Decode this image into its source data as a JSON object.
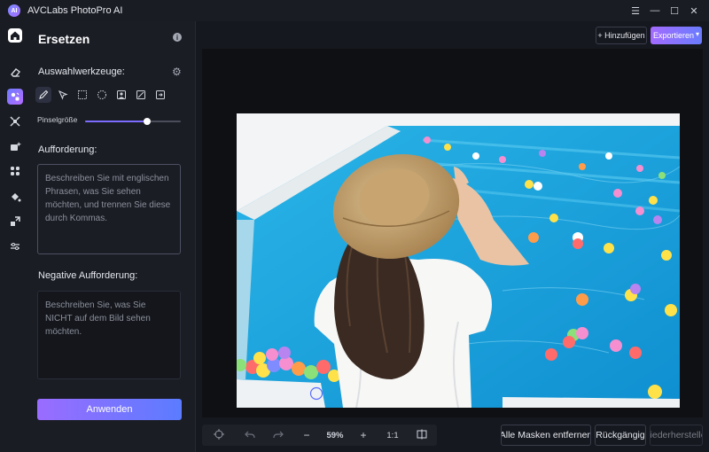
{
  "window": {
    "title": "AVCLabs PhotoPro AI",
    "logo_text": "AI",
    "controls": [
      "☰",
      "—",
      "☐",
      "✕"
    ]
  },
  "rail": {
    "items": [
      {
        "name": "home-icon"
      },
      {
        "name": "eraser-icon"
      },
      {
        "name": "replace-icon",
        "active": true
      },
      {
        "name": "upscale-icon"
      },
      {
        "name": "enhance-icon"
      },
      {
        "name": "face-icon"
      },
      {
        "name": "colorize-icon"
      },
      {
        "name": "resize-icon"
      },
      {
        "name": "adjust-icon"
      }
    ]
  },
  "panel": {
    "title": "Ersetzen",
    "selection_tools_label": "Auswahlwerkzeuge:",
    "brush_size_label": "Pinselgröße",
    "brush_size_fraction": 0.65,
    "prompt_label": "Aufforderung:",
    "prompt_placeholder": "Beschreiben Sie mit englischen Phrasen, was Sie sehen möchten, und trennen Sie diese durch Kommas.",
    "negative_label": "Negative Aufforderung:",
    "negative_placeholder": "Beschreiben Sie, was Sie NICHT auf dem Bild sehen möchten.",
    "apply_label": "Anwenden"
  },
  "toolbar": {
    "add_label": "+ Hinzufügen",
    "export_label": "Exportieren"
  },
  "zoom": {
    "minus": "−",
    "value": "59%",
    "plus": "+",
    "ratio": "1:1"
  },
  "actions": {
    "remove_masks": "Alle Masken entfernen",
    "undo": "Rückgängig",
    "redo": "Wiederherstellen"
  },
  "colors": {
    "accent_start": "#9a6cff",
    "accent_end": "#5b7cff",
    "pool": "#1aa3d6"
  }
}
